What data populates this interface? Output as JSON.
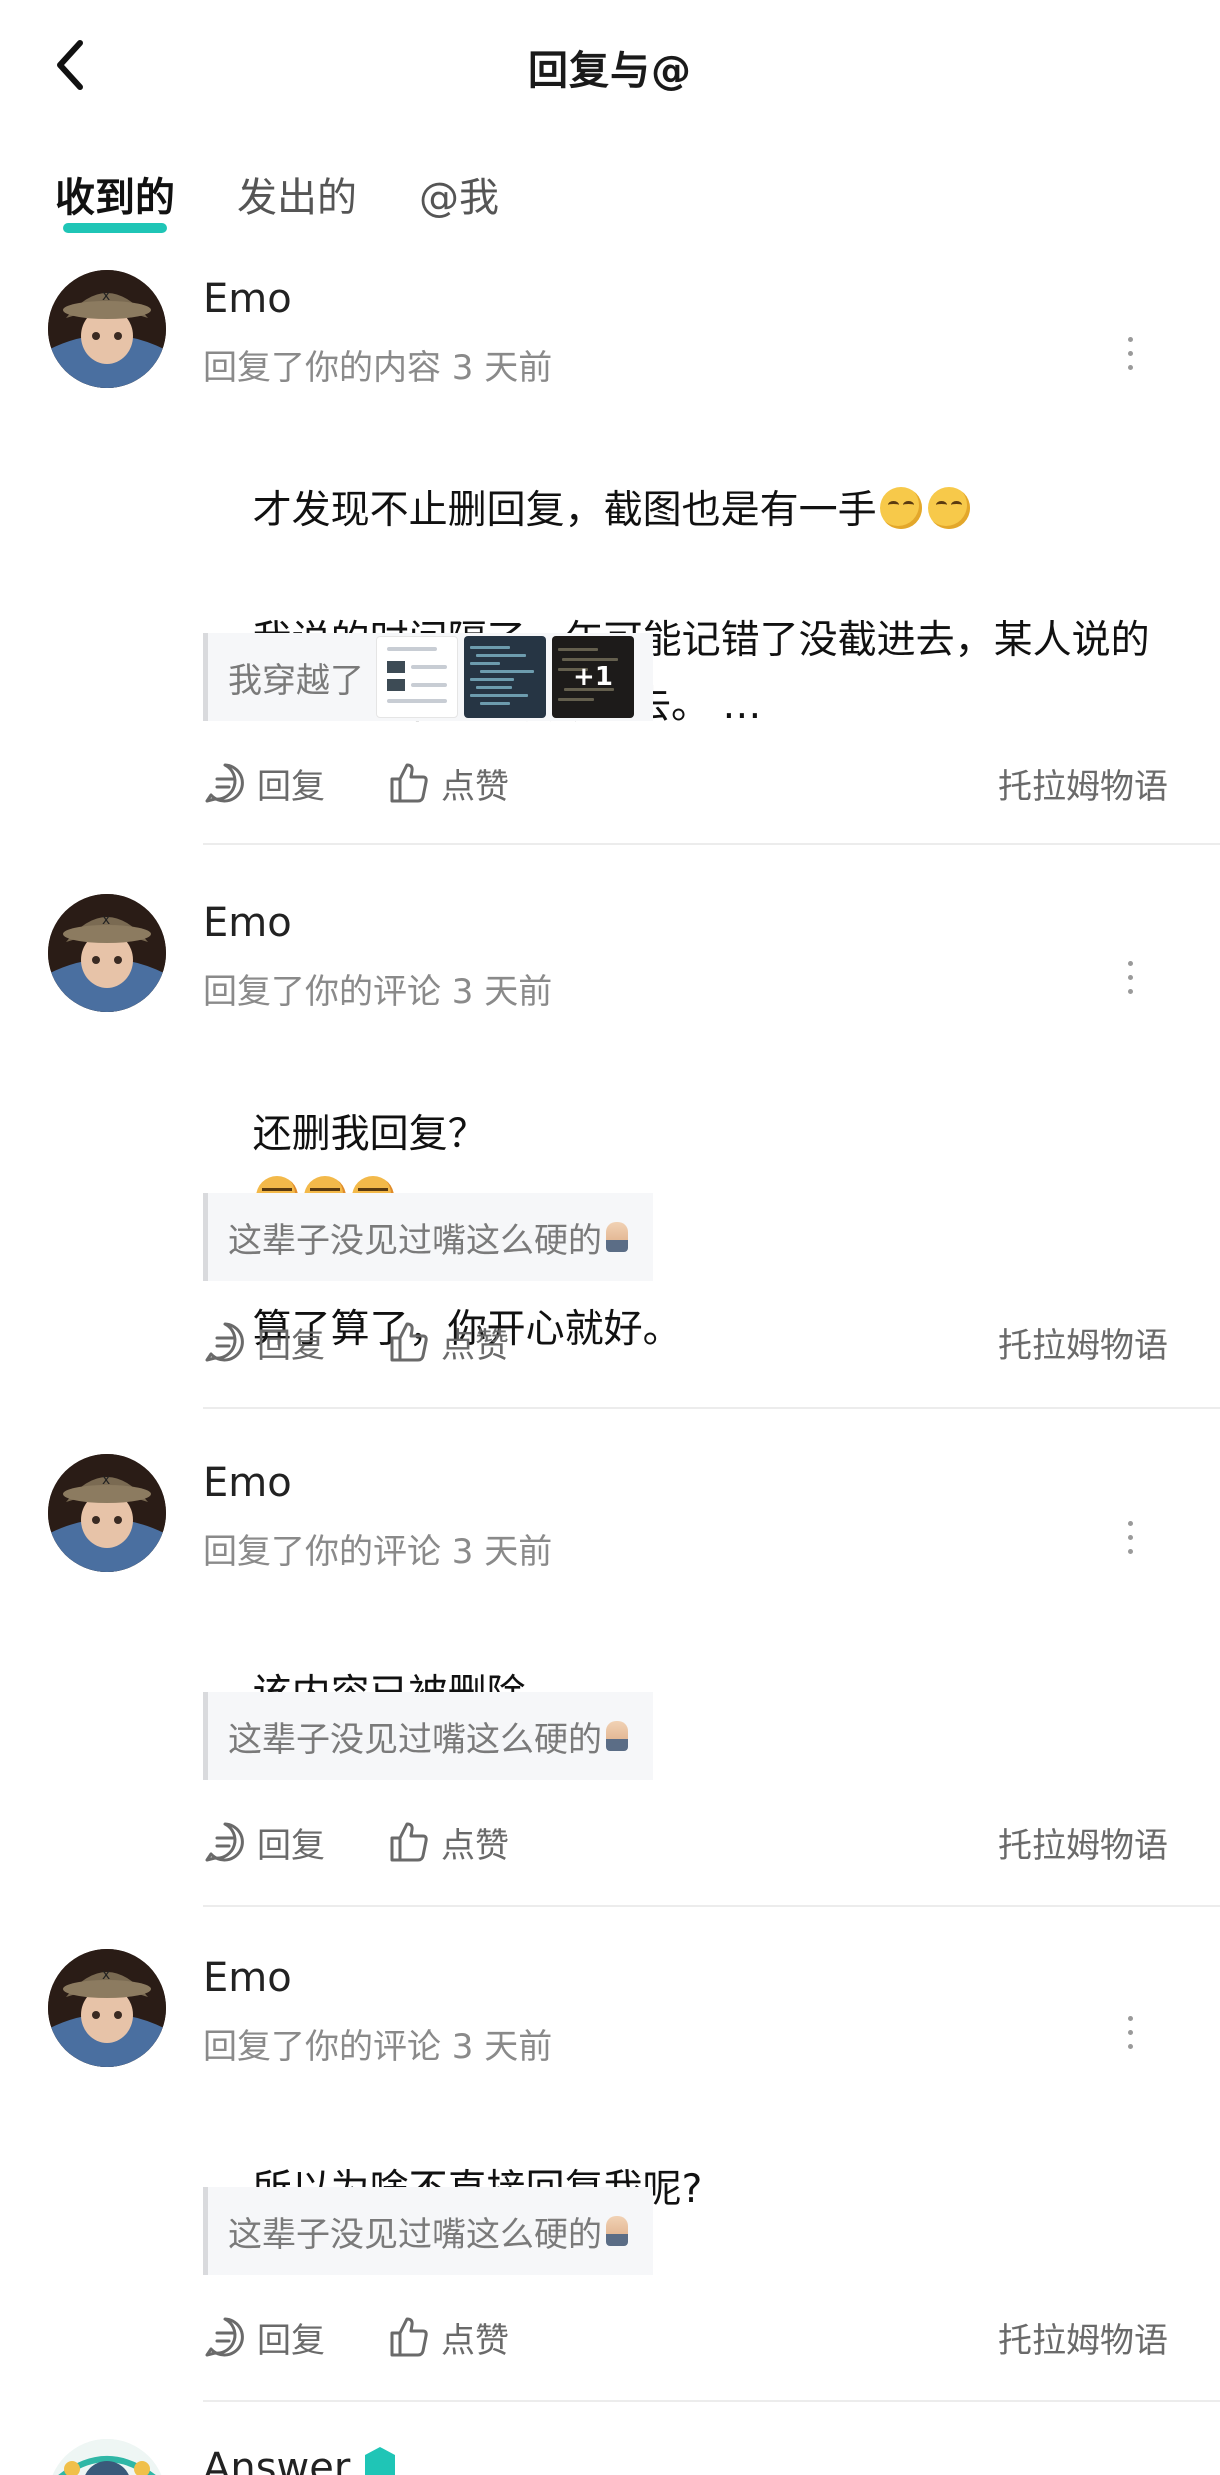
{
  "header": {
    "title": "回复与@"
  },
  "tabs": [
    {
      "label": "收到的",
      "active": true
    },
    {
      "label": "发出的",
      "active": false
    },
    {
      "label": "@我",
      "active": false
    }
  ],
  "colors": {
    "accent": "#1fc5b6",
    "text_primary": "#111111",
    "text_secondary": "#8a8a8a"
  },
  "actions": {
    "reply": "回复",
    "like": "点赞"
  },
  "items": [
    {
      "name": "Emo",
      "meta": "回复了你的内容 3 天前",
      "content_line1": "才发现不止删回复，截图也是有一手",
      "content_rest": "我说的时间隔了一年可能记错了没截进去，某人说的穿越时空的章鱼也没截进去。 …",
      "quote": "我穿越了",
      "quote_more": "+1",
      "source": "托拉姆物语"
    },
    {
      "name": "Emo",
      "meta": "回复了你的评论 3 天前",
      "content_line1": "还删我回复？",
      "content_rest": "算了算了，你开心就好。",
      "quote": "这辈子没见过嘴这么硬的",
      "source": "托拉姆物语"
    },
    {
      "name": "Emo",
      "meta": "回复了你的评论 3 天前",
      "content_line1": "该内容已被删除",
      "quote": "这辈子没见过嘴这么硬的",
      "source": "托拉姆物语"
    },
    {
      "name": "Emo",
      "meta": "回复了你的评论 3 天前",
      "content_line1": "所以为啥不直接回复我呢?",
      "quote": "这辈子没见过嘴这么硬的",
      "source": "托拉姆物语"
    },
    {
      "name": "Answer"
    }
  ]
}
